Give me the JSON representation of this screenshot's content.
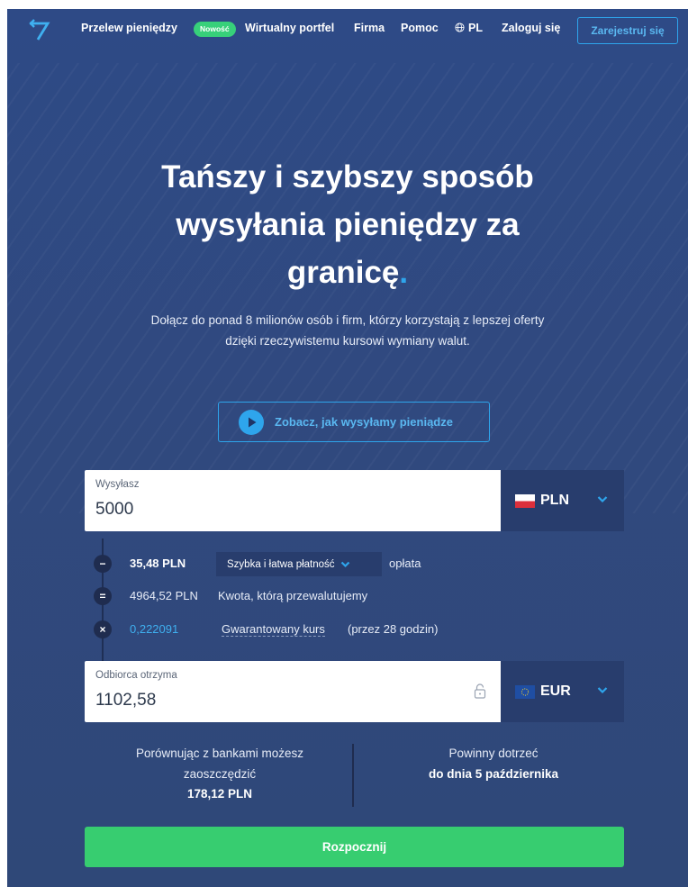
{
  "nav": {
    "send_money": "Przelew pieniędzy",
    "badge": "Nowość",
    "wallet": "Wirtualny portfel",
    "business": "Firma",
    "help": "Pomoc",
    "language": "PL",
    "login": "Zaloguj się",
    "signup": "Zarejestruj się"
  },
  "hero": {
    "title_lines": [
      "Tańszy i szybszy sposób",
      "wysyłania pieniędzy za",
      "granicę"
    ],
    "title_dot": ".",
    "subtitle": "Dołącz do ponad 8 milionów osób i firm, którzy korzystają z lepszej oferty dzięki rzeczywistemu kursowi wymiany walut.",
    "video_button": "Zobacz, jak wysyłamy pieniądze"
  },
  "calculator": {
    "send": {
      "label": "Wysyłasz",
      "value": "5000",
      "currency": "PLN"
    },
    "fee": {
      "amount": "35,48 PLN",
      "method": "Szybka i łatwa płatność",
      "suffix": "opłata"
    },
    "converted": {
      "amount": "4964,52 PLN",
      "text": "Kwota, którą przewalutujemy"
    },
    "rate": {
      "value": "0,222091",
      "link": "Gwarantowany kurs",
      "note": "(przez 28 godzin)"
    },
    "receive": {
      "label": "Odbiorca otrzyma",
      "value": "1102,58",
      "currency": "EUR"
    },
    "step_icons": {
      "minus": "−",
      "equals": "=",
      "times": "×"
    }
  },
  "summary": {
    "savings_line1": "Porównując z bankami możesz",
    "savings_line2": "zaoszczędzić",
    "savings_amount": "178,12 PLN",
    "arrival_line1": "Powinny dotrzeć",
    "arrival_line2": "do dnia 5 października"
  },
  "cta": {
    "label": "Rozpocznij"
  },
  "colors": {
    "background": "#2f4a82",
    "accent_blue": "#2ea5ec",
    "green": "#37cd70",
    "dark_panel": "#283d6d"
  },
  "icons": {
    "logo": "transferwise-logo-icon",
    "globe": "globe-icon",
    "play": "play-icon",
    "chevron": "chevron-down-icon",
    "lock": "lock-icon",
    "poland_flag": "poland-flag-icon",
    "eu_flag": "eu-flag-icon"
  }
}
